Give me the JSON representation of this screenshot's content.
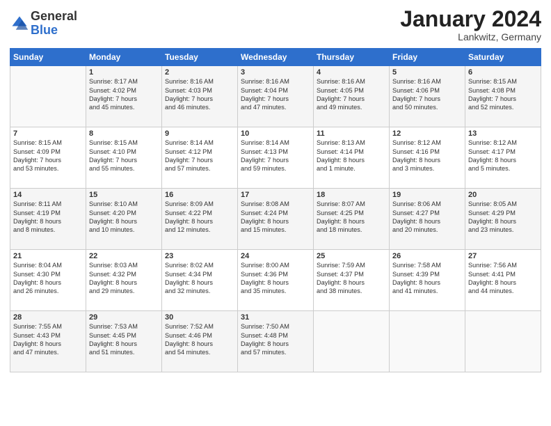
{
  "header": {
    "logo_general": "General",
    "logo_blue": "Blue",
    "month_year": "January 2024",
    "location": "Lankwitz, Germany"
  },
  "days_of_week": [
    "Sunday",
    "Monday",
    "Tuesday",
    "Wednesday",
    "Thursday",
    "Friday",
    "Saturday"
  ],
  "weeks": [
    [
      {
        "day": "",
        "content": ""
      },
      {
        "day": "1",
        "content": "Sunrise: 8:17 AM\nSunset: 4:02 PM\nDaylight: 7 hours\nand 45 minutes."
      },
      {
        "day": "2",
        "content": "Sunrise: 8:16 AM\nSunset: 4:03 PM\nDaylight: 7 hours\nand 46 minutes."
      },
      {
        "day": "3",
        "content": "Sunrise: 8:16 AM\nSunset: 4:04 PM\nDaylight: 7 hours\nand 47 minutes."
      },
      {
        "day": "4",
        "content": "Sunrise: 8:16 AM\nSunset: 4:05 PM\nDaylight: 7 hours\nand 49 minutes."
      },
      {
        "day": "5",
        "content": "Sunrise: 8:16 AM\nSunset: 4:06 PM\nDaylight: 7 hours\nand 50 minutes."
      },
      {
        "day": "6",
        "content": "Sunrise: 8:15 AM\nSunset: 4:08 PM\nDaylight: 7 hours\nand 52 minutes."
      }
    ],
    [
      {
        "day": "7",
        "content": "Sunrise: 8:15 AM\nSunset: 4:09 PM\nDaylight: 7 hours\nand 53 minutes."
      },
      {
        "day": "8",
        "content": "Sunrise: 8:15 AM\nSunset: 4:10 PM\nDaylight: 7 hours\nand 55 minutes."
      },
      {
        "day": "9",
        "content": "Sunrise: 8:14 AM\nSunset: 4:12 PM\nDaylight: 7 hours\nand 57 minutes."
      },
      {
        "day": "10",
        "content": "Sunrise: 8:14 AM\nSunset: 4:13 PM\nDaylight: 7 hours\nand 59 minutes."
      },
      {
        "day": "11",
        "content": "Sunrise: 8:13 AM\nSunset: 4:14 PM\nDaylight: 8 hours\nand 1 minute."
      },
      {
        "day": "12",
        "content": "Sunrise: 8:12 AM\nSunset: 4:16 PM\nDaylight: 8 hours\nand 3 minutes."
      },
      {
        "day": "13",
        "content": "Sunrise: 8:12 AM\nSunset: 4:17 PM\nDaylight: 8 hours\nand 5 minutes."
      }
    ],
    [
      {
        "day": "14",
        "content": "Sunrise: 8:11 AM\nSunset: 4:19 PM\nDaylight: 8 hours\nand 8 minutes."
      },
      {
        "day": "15",
        "content": "Sunrise: 8:10 AM\nSunset: 4:20 PM\nDaylight: 8 hours\nand 10 minutes."
      },
      {
        "day": "16",
        "content": "Sunrise: 8:09 AM\nSunset: 4:22 PM\nDaylight: 8 hours\nand 12 minutes."
      },
      {
        "day": "17",
        "content": "Sunrise: 8:08 AM\nSunset: 4:24 PM\nDaylight: 8 hours\nand 15 minutes."
      },
      {
        "day": "18",
        "content": "Sunrise: 8:07 AM\nSunset: 4:25 PM\nDaylight: 8 hours\nand 18 minutes."
      },
      {
        "day": "19",
        "content": "Sunrise: 8:06 AM\nSunset: 4:27 PM\nDaylight: 8 hours\nand 20 minutes."
      },
      {
        "day": "20",
        "content": "Sunrise: 8:05 AM\nSunset: 4:29 PM\nDaylight: 8 hours\nand 23 minutes."
      }
    ],
    [
      {
        "day": "21",
        "content": "Sunrise: 8:04 AM\nSunset: 4:30 PM\nDaylight: 8 hours\nand 26 minutes."
      },
      {
        "day": "22",
        "content": "Sunrise: 8:03 AM\nSunset: 4:32 PM\nDaylight: 8 hours\nand 29 minutes."
      },
      {
        "day": "23",
        "content": "Sunrise: 8:02 AM\nSunset: 4:34 PM\nDaylight: 8 hours\nand 32 minutes."
      },
      {
        "day": "24",
        "content": "Sunrise: 8:00 AM\nSunset: 4:36 PM\nDaylight: 8 hours\nand 35 minutes."
      },
      {
        "day": "25",
        "content": "Sunrise: 7:59 AM\nSunset: 4:37 PM\nDaylight: 8 hours\nand 38 minutes."
      },
      {
        "day": "26",
        "content": "Sunrise: 7:58 AM\nSunset: 4:39 PM\nDaylight: 8 hours\nand 41 minutes."
      },
      {
        "day": "27",
        "content": "Sunrise: 7:56 AM\nSunset: 4:41 PM\nDaylight: 8 hours\nand 44 minutes."
      }
    ],
    [
      {
        "day": "28",
        "content": "Sunrise: 7:55 AM\nSunset: 4:43 PM\nDaylight: 8 hours\nand 47 minutes."
      },
      {
        "day": "29",
        "content": "Sunrise: 7:53 AM\nSunset: 4:45 PM\nDaylight: 8 hours\nand 51 minutes."
      },
      {
        "day": "30",
        "content": "Sunrise: 7:52 AM\nSunset: 4:46 PM\nDaylight: 8 hours\nand 54 minutes."
      },
      {
        "day": "31",
        "content": "Sunrise: 7:50 AM\nSunset: 4:48 PM\nDaylight: 8 hours\nand 57 minutes."
      },
      {
        "day": "",
        "content": ""
      },
      {
        "day": "",
        "content": ""
      },
      {
        "day": "",
        "content": ""
      }
    ]
  ]
}
